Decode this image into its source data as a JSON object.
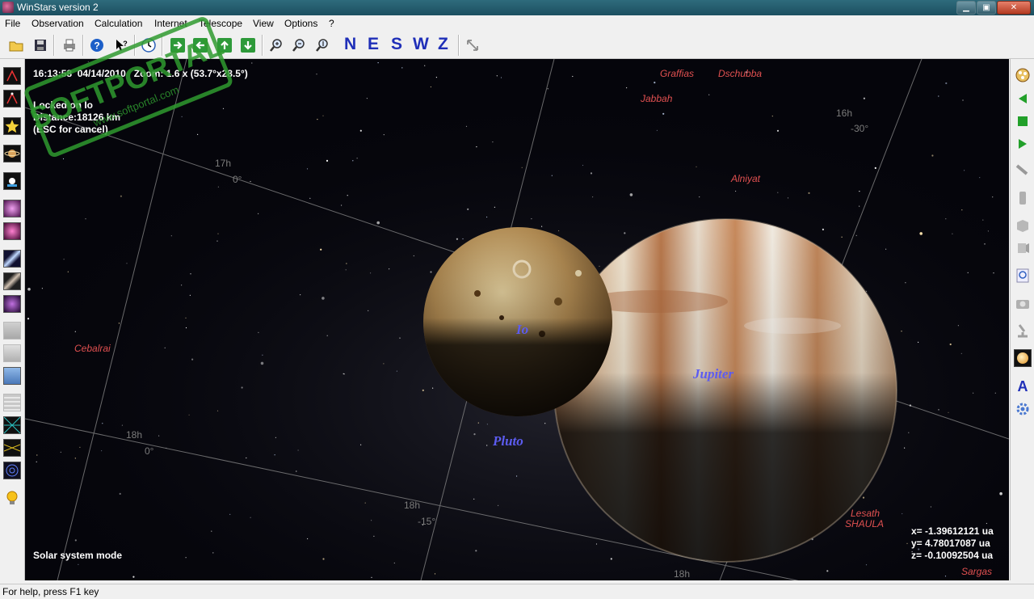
{
  "window": {
    "title": "WinStars version 2"
  },
  "menu": [
    "File",
    "Observation",
    "Calculation",
    "Internet",
    "Telescope",
    "View",
    "Options",
    "?"
  ],
  "toolbar": {
    "directions": [
      "N",
      "E",
      "S",
      "W",
      "Z"
    ]
  },
  "hud": {
    "time_zoom": "16:13:58  04/14/2010   Zoom: 1.6 x (53.7°x28.5°)",
    "lock_status": "Locked on Io",
    "distance": "Distance:18126 km",
    "esc_hint": "(ESC for cancel)",
    "mode": "Solar system mode",
    "coord_x": "x= -1.39612121 ua",
    "coord_y": "y= 4.78017087 ua",
    "coord_z": "z= -0.10092504 ua"
  },
  "stars": [
    {
      "name": "Graffias"
    },
    {
      "name": "Dschubba"
    },
    {
      "name": "Jabbah"
    },
    {
      "name": "Alniyat"
    },
    {
      "name": "Cebalrai"
    },
    {
      "name": "Lesath"
    },
    {
      "name": "SHAULA"
    },
    {
      "name": "Sargas"
    }
  ],
  "planets": {
    "io": "Io",
    "jupiter": "Jupiter",
    "pluto": "Pluto"
  },
  "grid_labels": [
    "17h",
    "0°",
    "16h",
    "-30°",
    "18h",
    "0°",
    "18h",
    "-15°",
    "18h"
  ],
  "watermark": {
    "text": "SOFTPORTAL",
    "url": "www.softportal.com"
  },
  "status": {
    "help": "For help, press F1 key"
  },
  "colors": {
    "star_label": "#e05050",
    "planet_label": "#5c5cf0",
    "direction": "#1f2fb8"
  }
}
